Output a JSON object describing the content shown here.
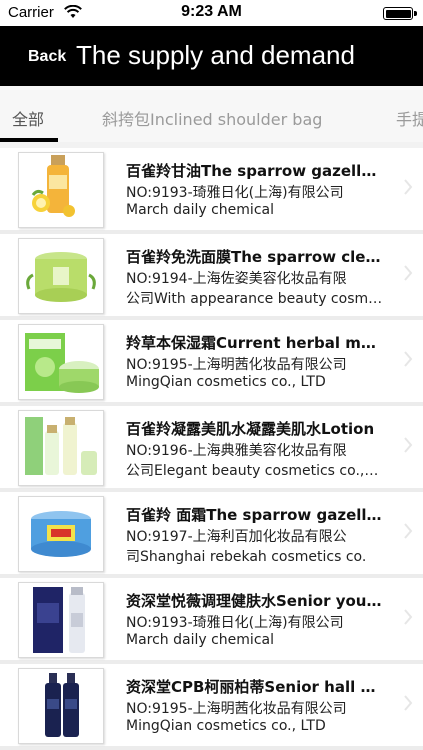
{
  "status_bar": {
    "carrier": "Carrier",
    "time": "9:23 AM"
  },
  "navbar": {
    "back_label": "Back",
    "title": "The supply and demand"
  },
  "tabs": [
    {
      "label": "全部"
    },
    {
      "label": "斜挎包Inclined shoulder bag"
    },
    {
      "label": "手提"
    }
  ],
  "items": [
    {
      "name": "百雀羚甘油The sparrow gazelle glycerin",
      "no": "NO:9193-琦雅日化(上海)有限公司",
      "company": "March daily chemical"
    },
    {
      "name": "百雀羚免洗面膜The sparrow clean mask",
      "no": "NO:9194-上海佐姿美容化妆品有限",
      "company": "公司With appearance beauty cosmetics"
    },
    {
      "name": "羚草本保湿霜Current herbal moisturizer",
      "no": "NO:9195-上海明茜化妆品有限公司",
      "company": "MingQian cosmetics co., LTD"
    },
    {
      "name": "百雀羚凝露美肌水凝露美肌水Lotion",
      "no": "NO:9196-上海典雅美容化妆品有限",
      "company": "公司Elegant beauty cosmetics co.,Ltd"
    },
    {
      "name": "百雀羚 面霜The sparrow gazelle cream",
      "no": "NO:9197-上海利百加化妆品有限公",
      "company": "司Shanghai rebekah cosmetics co."
    },
    {
      "name": "资深堂悦薇调理健肤水Senior youth water",
      "no": "NO:9193-琦雅日化(上海)有限公司",
      "company": "March daily chemical"
    },
    {
      "name": "资深堂CPB柯丽柏蒂Senior hall CPB",
      "no": "NO:9195-上海明茜化妆品有限公司",
      "company": "MingQian cosmetics co., LTD"
    }
  ],
  "colors": {
    "navbar_bg": "#000000",
    "accent": "#000000",
    "tab_inactive": "#9a9a9a"
  },
  "icons": {
    "wifi": "wifi-icon",
    "battery": "battery-icon",
    "chevron": "chevron-right-icon"
  }
}
